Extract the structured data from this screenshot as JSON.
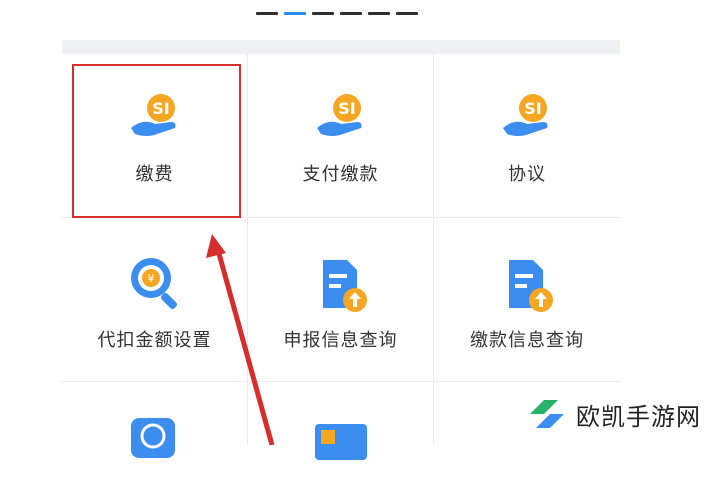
{
  "pager": {
    "count": 6,
    "active_index": 1
  },
  "grid": {
    "rows": [
      [
        {
          "label": "缴费",
          "icon": "social-insurance-hand-icon"
        },
        {
          "label": "支付缴款",
          "icon": "social-insurance-hand-icon"
        },
        {
          "label": "协议",
          "icon": "social-insurance-hand-icon"
        }
      ],
      [
        {
          "label": "代扣金额设置",
          "icon": "magnifier-coin-icon"
        },
        {
          "label": "申报信息查询",
          "icon": "document-upload-icon"
        },
        {
          "label": "缴款信息查询",
          "icon": "document-upload-icon"
        }
      ],
      [
        {
          "label": "",
          "icon": "circular-arrow-icon"
        },
        {
          "label": "",
          "icon": "id-card-icon"
        },
        {
          "label": "",
          "icon": ""
        }
      ]
    ]
  },
  "watermark": {
    "text": "欧凯手游网"
  },
  "colors": {
    "highlight": "#d72d2d",
    "accent_orange": "#f5a623",
    "accent_blue": "#3b8df0"
  }
}
